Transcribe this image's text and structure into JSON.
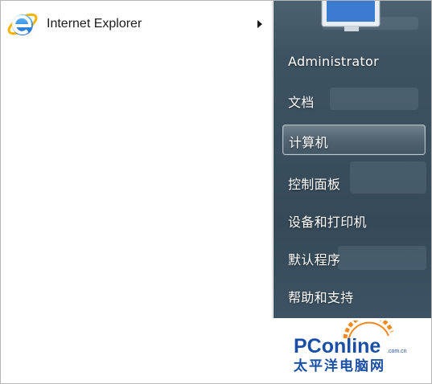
{
  "programs": [
    {
      "label": "Internet Explorer",
      "icon": "internet-explorer-icon",
      "has_submenu": true
    }
  ],
  "right_menu": {
    "user_name": "Administrator",
    "items": [
      {
        "label": "文档"
      },
      {
        "label": "计算机",
        "highlighted": true
      },
      {
        "label": "控制面板"
      },
      {
        "label": "设备和打印机"
      },
      {
        "label": "默认程序"
      },
      {
        "label": "帮助和支持"
      }
    ]
  },
  "watermark": {
    "brand_1": "PConline",
    "domain_suffix": ".com.cn",
    "brand_2": "太平洋电脑网"
  },
  "colors": {
    "right_pane": "#3d5261",
    "ie_blue": "#1e7bd8",
    "ie_yellow": "#f5b400",
    "watermark_blue": "#1a4fa6",
    "watermark_orange": "#f08a1c"
  }
}
